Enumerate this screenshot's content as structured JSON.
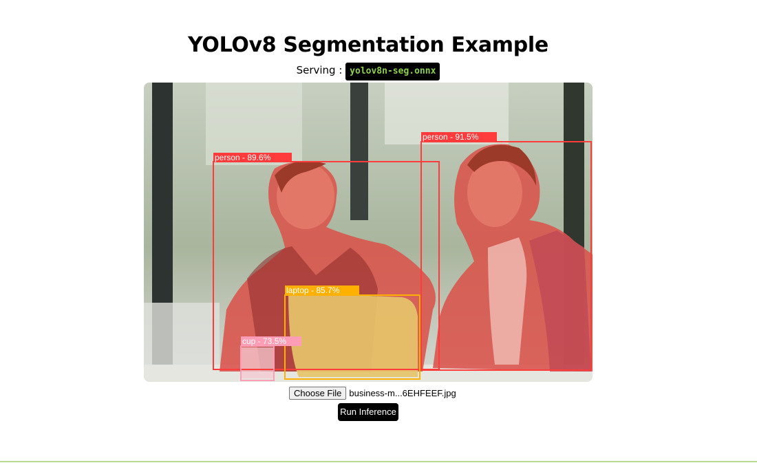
{
  "page": {
    "title": "YOLOv8 Segmentation Example",
    "serving_label": "Serving :",
    "model_name": "yolov8n-seg.onnx"
  },
  "controls": {
    "choose_file_label": "Choose File",
    "file_name": "business-m...6EHFEEF.jpg",
    "run_label": "Run Inference"
  },
  "detections": [
    {
      "label": "person - 89.6%",
      "class": "person",
      "score": 89.6,
      "color": "#ff3b3b"
    },
    {
      "label": "person - 91.5%",
      "class": "person",
      "score": 91.5,
      "color": "#ff3b3b"
    },
    {
      "label": "laptop - 85.7%",
      "class": "laptop",
      "score": 85.7,
      "color": "#ffb000"
    },
    {
      "label": "cup - 73.5%",
      "class": "cup",
      "score": 73.5,
      "color": "#ff9db6"
    }
  ],
  "colors": {
    "accent_bar": "#b7d992",
    "model_text": "#8fd14a"
  }
}
